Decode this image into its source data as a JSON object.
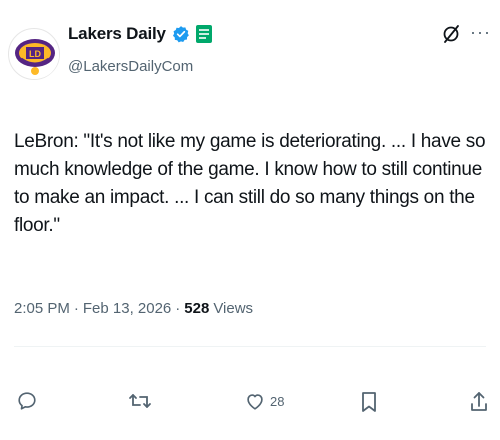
{
  "author": {
    "display_name": "Lakers Daily",
    "handle": "@LakersDailyCom"
  },
  "tweet": {
    "text": "LeBron: \"It's not like my game is deteriorating. ... I have so much knowledge of the game. I know how to still continue to make an impact. ... I can still do so many things on the floor.\""
  },
  "meta": {
    "time": "2:05 PM",
    "sep1": "·",
    "date": "Feb 13, 2026",
    "sep2": "·",
    "views_count": "528",
    "views_label": "Views"
  },
  "actions": {
    "like_count": "28"
  },
  "colors": {
    "text": "#0f1419",
    "secondary": "#536471",
    "verified": "#1d9bf0",
    "affiliate": "#00a86b",
    "lakers_purple": "#552583",
    "lakers_gold": "#fdb927"
  },
  "icons": [
    "verified-icon",
    "affiliate-badge-icon",
    "grok-icon",
    "more-icon",
    "reply-icon",
    "retweet-icon",
    "like-icon",
    "bookmark-icon",
    "share-icon"
  ]
}
